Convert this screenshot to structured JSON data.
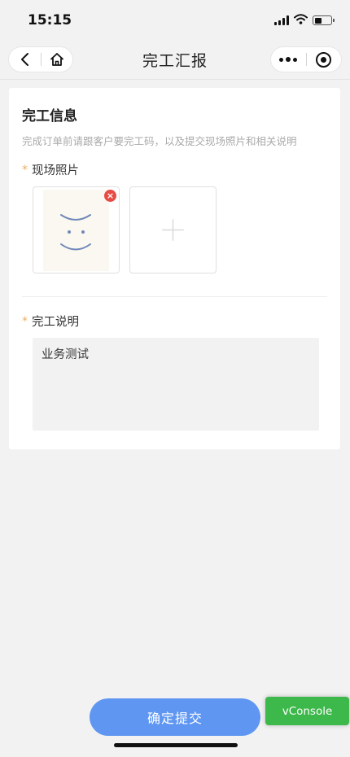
{
  "status_bar": {
    "time": "15:15",
    "icons": [
      "signal-icon",
      "wifi-icon",
      "battery-icon"
    ]
  },
  "nav": {
    "title": "完工汇报",
    "left_icons": [
      "back-icon",
      "home-icon"
    ],
    "right_icons": [
      "more-icon",
      "target-icon"
    ]
  },
  "card": {
    "title": "完工信息",
    "description": "完成订单前请跟客户要完工码，以及提交现场照片和相关说明",
    "required_mark": "*",
    "photos_label": "现场照片",
    "photo_remove_symbol": "×",
    "remark_label": "完工说明",
    "remark_value": "业务测试"
  },
  "footer": {
    "submit_label": "确定提交",
    "vconsole_label": "vConsole"
  },
  "colors": {
    "accent_blue": "#5f96f2",
    "required_star": "#e8b06a",
    "remove_red": "#e74c44",
    "vconsole_green": "#3db84a"
  }
}
